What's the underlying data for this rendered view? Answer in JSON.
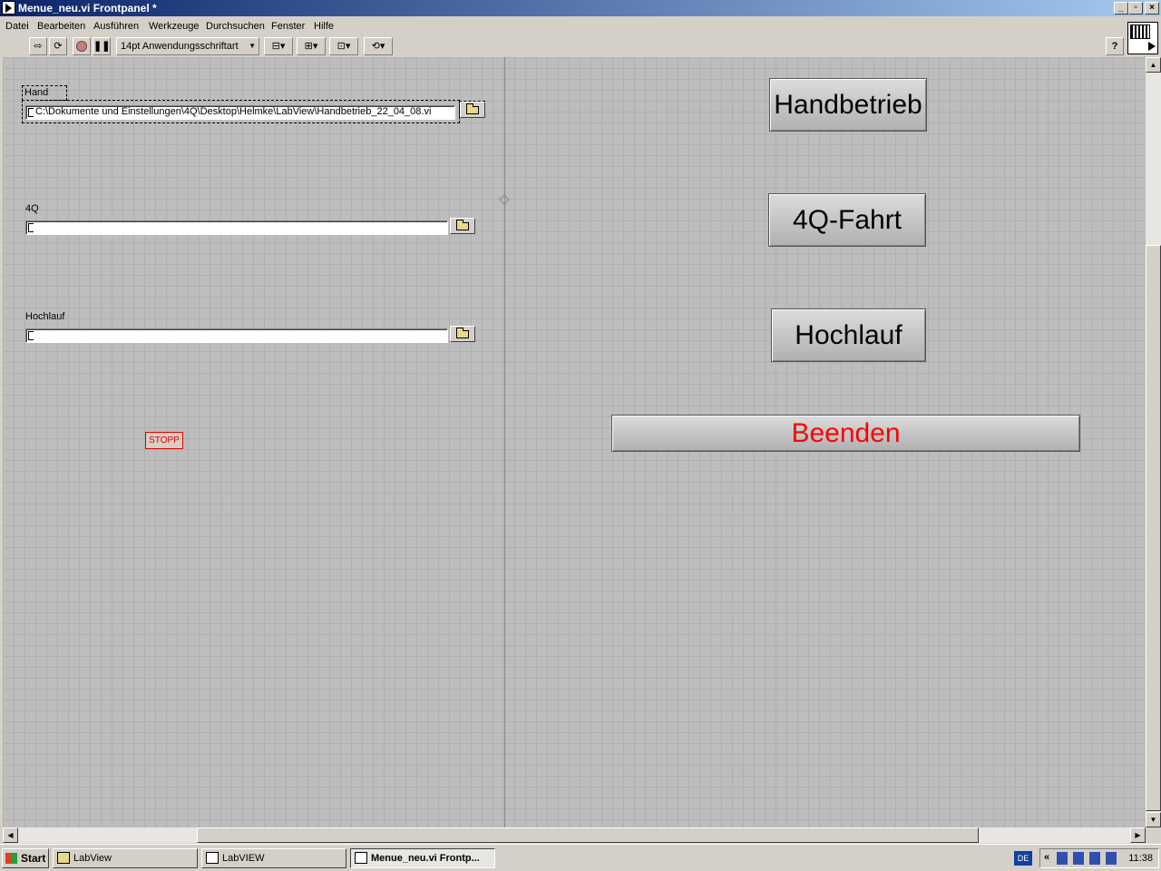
{
  "window": {
    "title": "Menue_neu.vi Frontpanel *",
    "controls": [
      "_",
      "▫",
      "×"
    ]
  },
  "menubar": {
    "items": [
      {
        "label": "Datei"
      },
      {
        "label": "Bearbeiten"
      },
      {
        "label": "Ausführen"
      },
      {
        "label": "Werkzeuge"
      },
      {
        "label": "Durchsuchen"
      },
      {
        "label": "Fenster"
      },
      {
        "label": "Hilfe"
      }
    ]
  },
  "toolbar": {
    "font_select": "14pt Anwendungsschriftart",
    "help_label": "?"
  },
  "panel": {
    "hand": {
      "label": "Hand",
      "path": "C:\\Dokumente und Einstellungen\\4Q\\Desktop\\Helmke\\LabView\\Handbetrieb_22_04_08.vi"
    },
    "q4": {
      "label": "4Q",
      "path": ""
    },
    "hochlauf": {
      "label": "Hochlauf",
      "path": ""
    },
    "stop_label": "STOPP",
    "buttons": {
      "handbetrieb": "Handbetrieb",
      "fahrt": "4Q-Fahrt",
      "hochlauf": "Hochlauf",
      "beenden": "Beenden"
    },
    "beenden_color": "#ff0000"
  },
  "taskbar": {
    "start_label": "Start",
    "tasks": [
      {
        "label": "LabView"
      },
      {
        "label": "LabVIEW"
      },
      {
        "label": "Menue_neu.vi Frontp..."
      }
    ],
    "lang": "DE",
    "chevron": "«",
    "clock": "11:38"
  }
}
